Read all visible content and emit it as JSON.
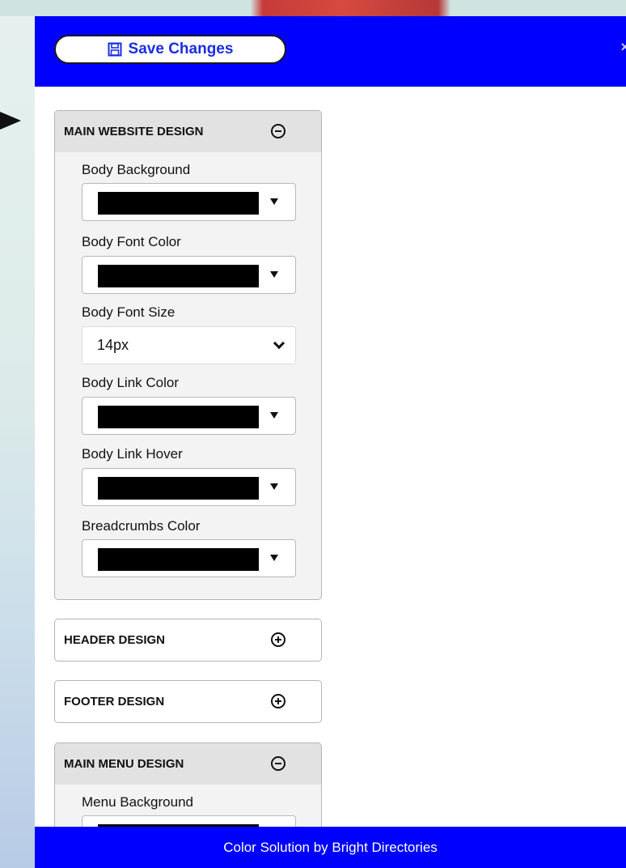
{
  "toolbar": {
    "save_label": "Save Changes",
    "close_glyph": "×"
  },
  "icons": {
    "save": "floppy-disk-icon",
    "collapse": "minus-circle-icon",
    "expand": "plus-circle-icon",
    "pointer": "arrow-right-icon"
  },
  "colors": {
    "bar": "#0000ff",
    "swatch": "#000000"
  },
  "sections": {
    "main_website": {
      "title": "MAIN WEBSITE DESIGN",
      "state": "expanded",
      "fields": {
        "body_background": {
          "label": "Body Background",
          "value": "#000000"
        },
        "body_font_color": {
          "label": "Body Font Color",
          "value": "#000000"
        },
        "body_font_size": {
          "label": "Body Font Size",
          "value": "14px"
        },
        "body_link_color": {
          "label": "Body Link Color",
          "value": "#000000"
        },
        "body_link_hover": {
          "label": "Body Link Hover",
          "value": "#000000"
        },
        "breadcrumbs_color": {
          "label": "Breadcrumbs Color",
          "value": "#000000"
        }
      }
    },
    "header": {
      "title": "HEADER DESIGN",
      "state": "collapsed"
    },
    "footer": {
      "title": "FOOTER DESIGN",
      "state": "collapsed"
    },
    "main_menu": {
      "title": "MAIN MENU DESIGN",
      "state": "expanded",
      "fields": {
        "menu_background": {
          "label": "Menu Background",
          "value": "#000000"
        }
      }
    }
  },
  "footer": {
    "credit": "Color Solution by Bright Directories"
  }
}
